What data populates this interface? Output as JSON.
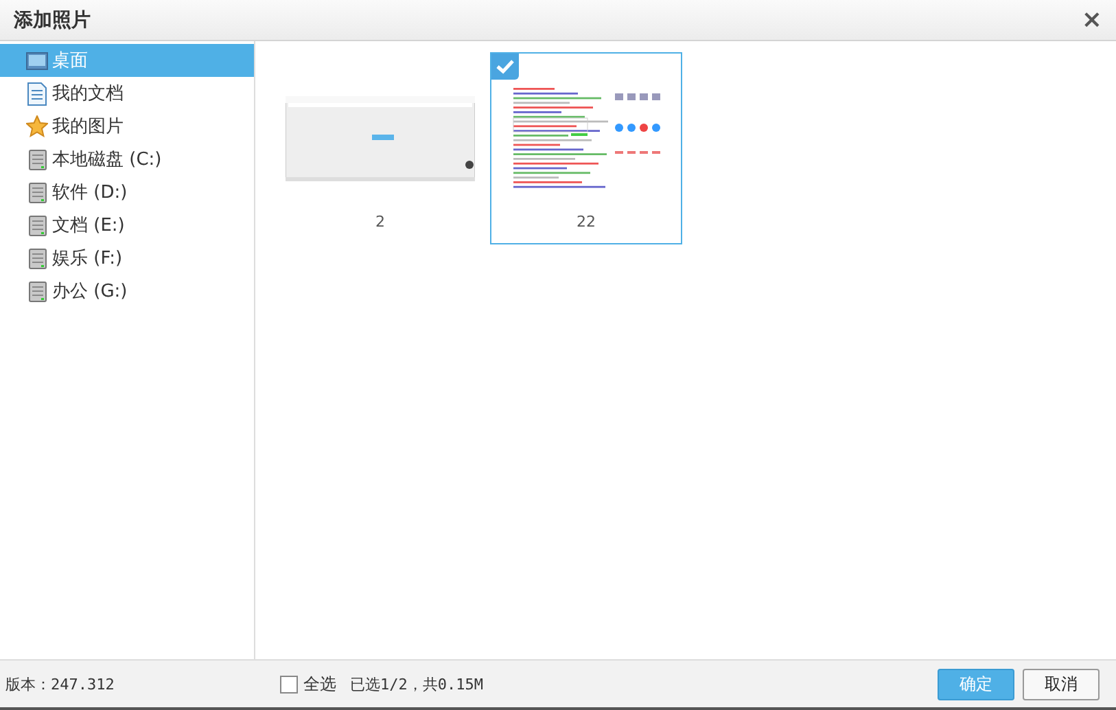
{
  "window": {
    "title": "添加照片",
    "close": "×"
  },
  "sidebar": {
    "items": [
      {
        "label": "桌面",
        "kind": "desktop",
        "selected": true
      },
      {
        "label": "我的文档",
        "kind": "document",
        "selected": false
      },
      {
        "label": "我的图片",
        "kind": "star",
        "selected": false
      },
      {
        "label": "本地磁盘 (C:)",
        "kind": "drive",
        "selected": false
      },
      {
        "label": "软件 (D:)",
        "kind": "drive",
        "selected": false
      },
      {
        "label": "文档 (E:)",
        "kind": "drive",
        "selected": false
      },
      {
        "label": "娱乐 (F:)",
        "kind": "drive",
        "selected": false
      },
      {
        "label": "办公 (G:)",
        "kind": "drive",
        "selected": false
      }
    ]
  },
  "photos": [
    {
      "name": "2",
      "kind": "blank",
      "selected": false
    },
    {
      "name": "22",
      "kind": "results",
      "selected": true
    }
  ],
  "footer": {
    "version": "版本：247.312",
    "select_all": {
      "label": "全选",
      "checked": false
    },
    "summary": "已选1/2，共0.15M",
    "buttons": [
      {
        "label": "确定",
        "kind": "primary"
      },
      {
        "label": "取消",
        "kind": "default"
      }
    ]
  }
}
